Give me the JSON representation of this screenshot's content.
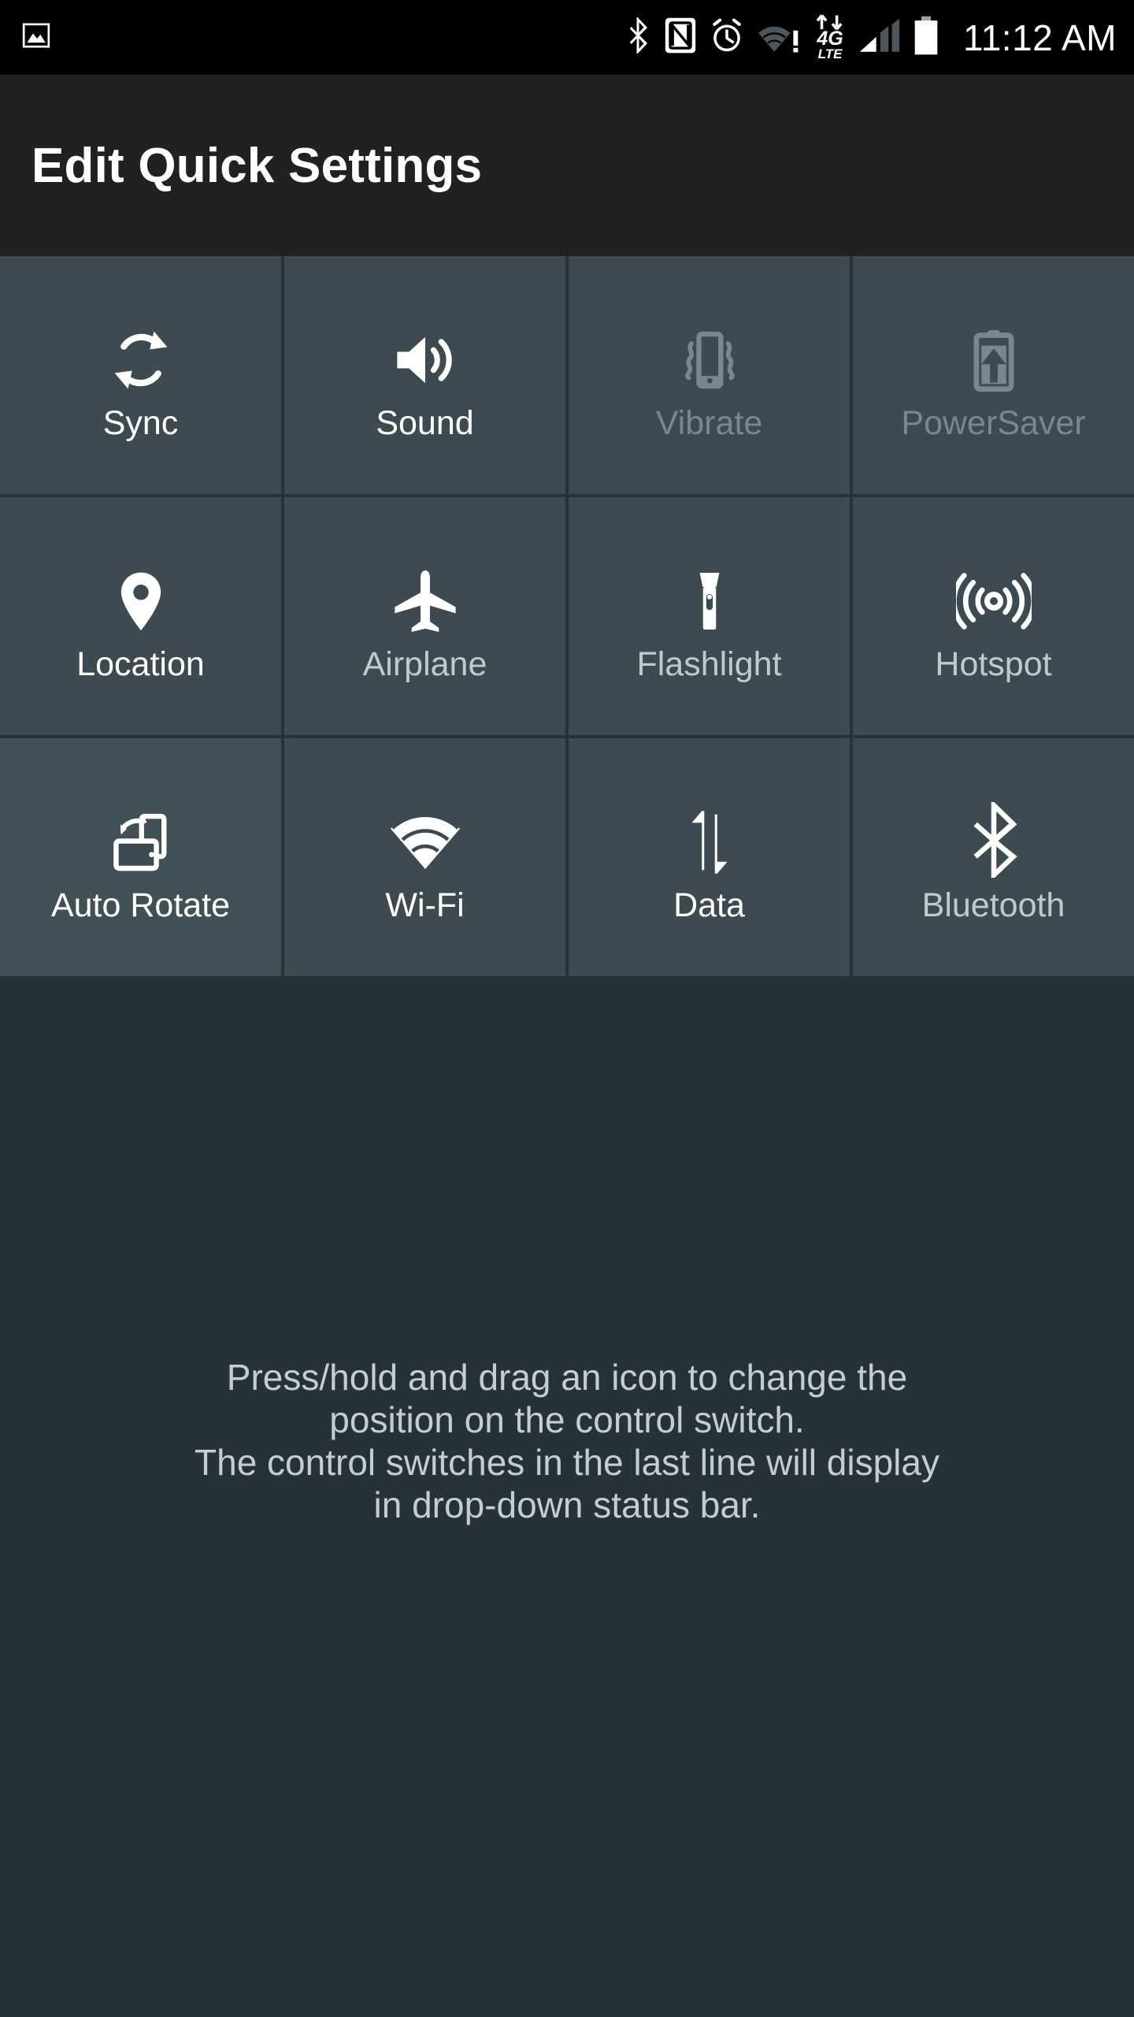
{
  "status_bar": {
    "notification_icons": [
      {
        "name": "photo-icon",
        "label": "Photo"
      }
    ],
    "system_icons": [
      {
        "name": "bluetooth-icon",
        "label": "Bluetooth"
      },
      {
        "name": "nfc-icon",
        "label": "NFC"
      },
      {
        "name": "alarm-clock-icon",
        "label": "Alarm"
      },
      {
        "name": "wifi-warning-icon",
        "label": "Wi-Fi no internet"
      },
      {
        "name": "data-4g-lte-icon",
        "label": "4G LTE"
      },
      {
        "name": "cellular-signal-icon",
        "label": "Signal"
      },
      {
        "name": "battery-icon",
        "label": "Battery"
      }
    ],
    "network_label_primary": "4G",
    "network_label_secondary": "LTE",
    "wifi_warning_glyph": "!",
    "clock": "11:12 AM",
    "background_color": "#000000",
    "icon_color": "#ffffff",
    "inactive_icon_color": "#4c565c"
  },
  "header": {
    "title": "Edit Quick Settings",
    "background_color": "#212121",
    "text_color": "#ffffff"
  },
  "tiles": {
    "active_color": "#ffffff",
    "disabled_color": "#7b868d",
    "tile_background": "#3d4a52",
    "tile_background_alt": "#414f57",
    "rows": [
      [
        {
          "label": "Sync",
          "icon": "sync-icon",
          "enabled": true,
          "dim_label": false
        },
        {
          "label": "Sound",
          "icon": "sound-icon",
          "enabled": true,
          "dim_label": false
        },
        {
          "label": "Vibrate",
          "icon": "vibrate-icon",
          "enabled": false,
          "dim_label": true
        },
        {
          "label": "PowerSaver",
          "icon": "power-saver-icon",
          "enabled": false,
          "dim_label": true
        }
      ],
      [
        {
          "label": "Location",
          "icon": "location-pin-icon",
          "enabled": true,
          "dim_label": false
        },
        {
          "label": "Airplane",
          "icon": "airplane-icon",
          "enabled": true,
          "dim_label": true
        },
        {
          "label": "Flashlight",
          "icon": "flashlight-icon",
          "enabled": true,
          "dim_label": true
        },
        {
          "label": "Hotspot",
          "icon": "hotspot-icon",
          "enabled": true,
          "dim_label": true
        }
      ],
      [
        {
          "label": "Auto Rotate",
          "icon": "auto-rotate-icon",
          "enabled": true,
          "dim_label": false
        },
        {
          "label": "Wi-Fi",
          "icon": "wifi-icon",
          "enabled": true,
          "dim_label": false
        },
        {
          "label": "Data",
          "icon": "mobile-data-icon",
          "enabled": true,
          "dim_label": false
        },
        {
          "label": "Bluetooth",
          "icon": "bluetooth-tile-icon",
          "enabled": true,
          "dim_label": true
        }
      ]
    ]
  },
  "instructions": {
    "line1": "Press/hold and drag an icon to change the",
    "line2": "position on the control switch.",
    "line3": "The control switches in the last line will display",
    "line4": "in drop-down status bar.",
    "text_color": "#c6cdd1"
  },
  "page": {
    "background_color": "#263238"
  }
}
